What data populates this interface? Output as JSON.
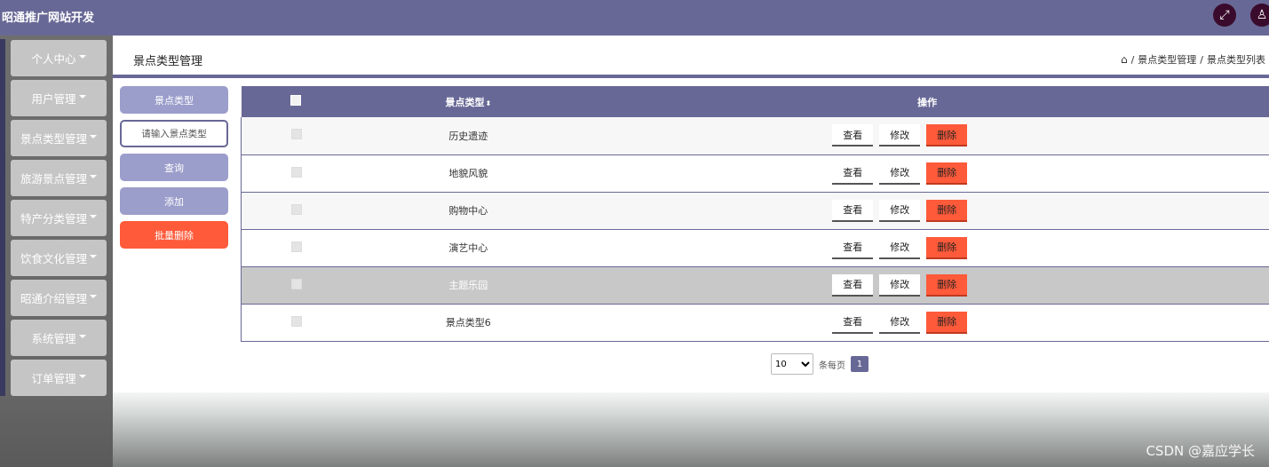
{
  "app": {
    "title": "昭通推广网站开发"
  },
  "topbar": {
    "icons": [
      "fullscreen-icon",
      "user-icon"
    ]
  },
  "sidebar": {
    "items": [
      {
        "label": "个人中心"
      },
      {
        "label": "用户管理"
      },
      {
        "label": "景点类型管理"
      },
      {
        "label": "旅游景点管理"
      },
      {
        "label": "特产分类管理"
      },
      {
        "label": "饮食文化管理"
      },
      {
        "label": "昭通介绍管理"
      },
      {
        "label": "系统管理"
      },
      {
        "label": "订单管理"
      }
    ]
  },
  "header": {
    "title": "景点类型管理",
    "breadcrumb": [
      "景点类型管理",
      "景点类型列表"
    ],
    "breadcrumb_sep": "/"
  },
  "search": {
    "field_label": "景点类型",
    "placeholder": "请输入景点类型",
    "query_label": "查询",
    "add_label": "添加",
    "batch_delete_label": "批量删除"
  },
  "table": {
    "columns": [
      "景点类型",
      "操作"
    ],
    "rows": [
      {
        "name": "历史遗迹"
      },
      {
        "name": "地貌风貌"
      },
      {
        "name": "购物中心"
      },
      {
        "name": "演艺中心"
      },
      {
        "name": "主题乐园"
      },
      {
        "name": "景点类型6"
      }
    ],
    "actions": {
      "view": "查看",
      "edit": "修改",
      "delete": "删除"
    }
  },
  "pagination": {
    "page_size": "10",
    "page_size_options": [
      "10"
    ],
    "per_page_label": "条每页",
    "current_page": "1"
  },
  "watermark": "CSDN @嘉应学长",
  "colors": {
    "primary": "#686897",
    "danger": "#ff5a3a",
    "accent_light": "#9b9dcb"
  }
}
